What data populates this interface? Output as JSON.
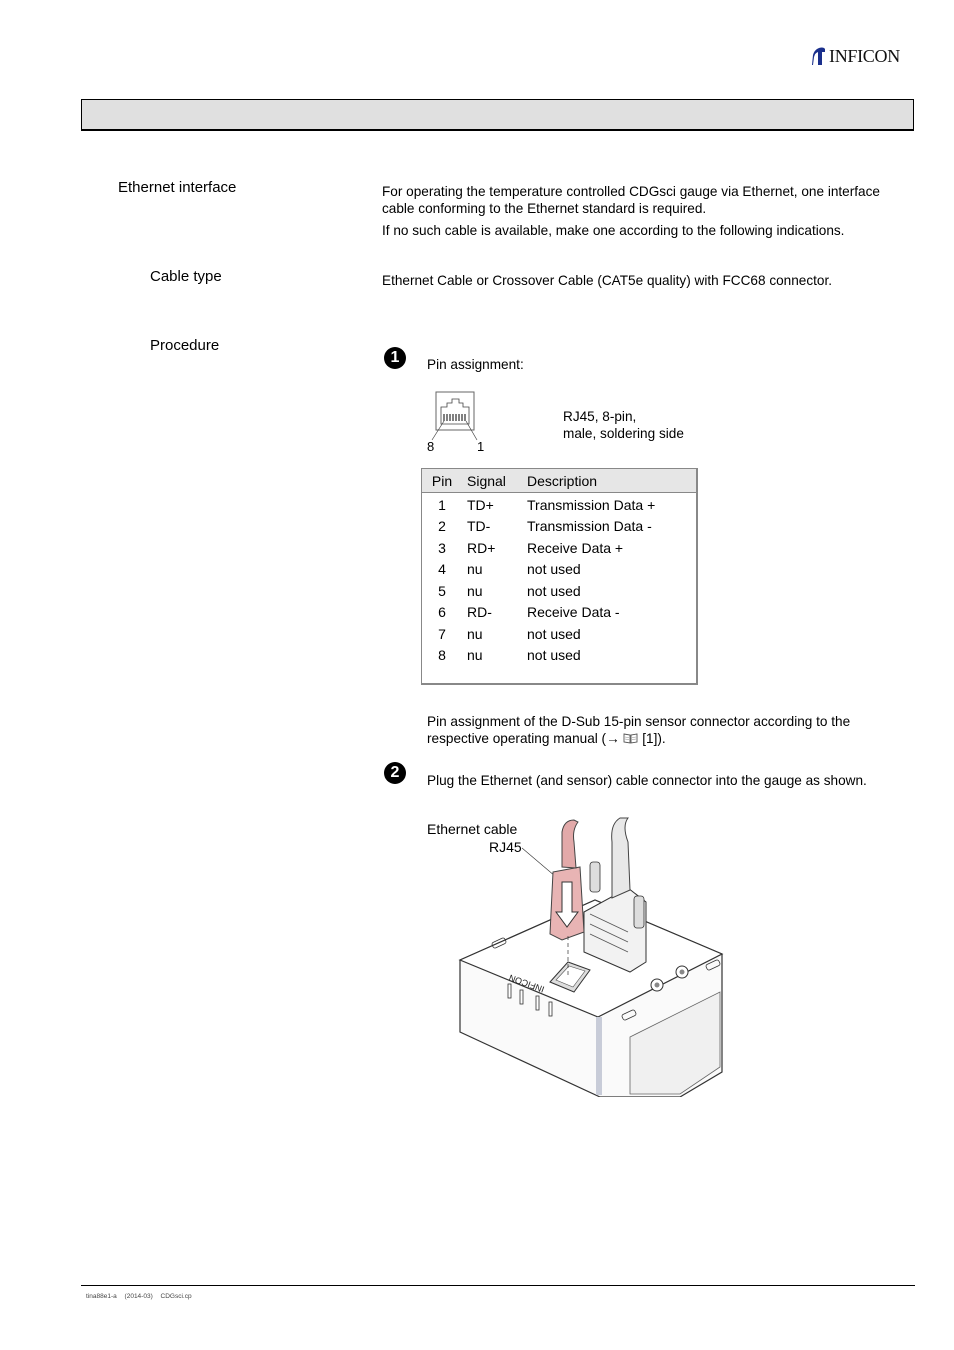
{
  "header": {
    "logo_text": "INFICON",
    "logo_icon": "inficon-logo-icon"
  },
  "sections": {
    "ethernet_interface": {
      "label": "Ethernet interface",
      "paragraph1": "For operating the temperature controlled CDGsci gauge via Ethernet, one interface cable conforming to the Ethernet standard is required.",
      "paragraph1_line1": "For operating the temperature controlled CDGsci gauge via Ethernet, one interface",
      "paragraph1_line2": "cable conforming to the Ethernet standard is required.",
      "paragraph2": "If no such cable is available, make one according to the following indications."
    },
    "cable_type": {
      "label": "Cable type",
      "text": "Ethernet Cable or Crossover Cable (CAT5e quality) with FCC68 connector."
    },
    "procedure": {
      "label": "Procedure",
      "steps": [
        {
          "number": "1",
          "text": "Pin assignment:",
          "connector": {
            "icon": "rj45-connector-icon",
            "pin_left": "8",
            "pin_right": "1",
            "caption_line1": "RJ45, 8-pin,",
            "caption_line2": "male, soldering side"
          },
          "table": {
            "headers": [
              "Pin",
              "Signal",
              "Description"
            ],
            "rows": [
              [
                "1",
                "TD+",
                "Transmission Data +"
              ],
              [
                "2",
                "TD-",
                "Transmission Data -"
              ],
              [
                "3",
                "RD+",
                "Receive Data +"
              ],
              [
                "4",
                "nu",
                "not used"
              ],
              [
                "5",
                "nu",
                "not used"
              ],
              [
                "6",
                "RD-",
                "Receive Data -"
              ],
              [
                "7",
                "nu",
                "not used"
              ],
              [
                "8",
                "nu",
                "not used"
              ]
            ]
          },
          "note_line1": "Pin assignment of the D-Sub 15-pin sensor connector according to the",
          "note_line2_pre": "respective operating manual (→ ",
          "note_icon": "book-icon",
          "note_line2_post": " [1])."
        },
        {
          "number": "2",
          "text": "Plug the Ethernet (and sensor) cable connector into the gauge as shown.",
          "figure": {
            "label_line1": "Ethernet cable",
            "label_line2": "RJ45",
            "brand_on_device": "INFICON"
          }
        }
      ]
    }
  },
  "footer": {
    "doc_id": "tina88e1-a",
    "date": "(2014-03)",
    "file": "CDGsci.cp"
  },
  "colors": {
    "header_bar": "#e0e0e0",
    "logo_blue": "#1a2f8c",
    "cable_pink": "#e8b4b4"
  }
}
